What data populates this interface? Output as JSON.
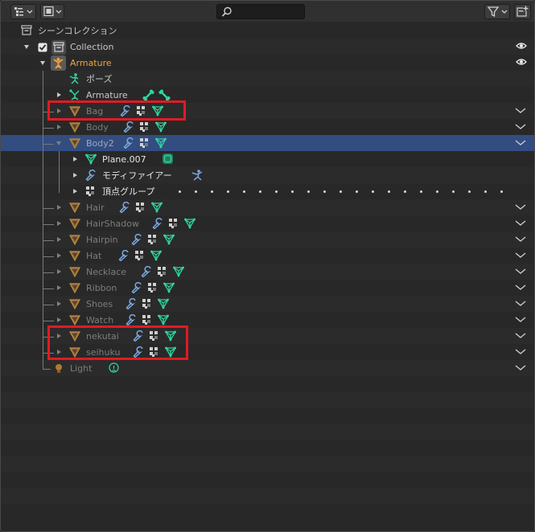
{
  "search": {
    "value": ""
  },
  "tree": {
    "scene_collection": "シーンコレクション",
    "collection": "Collection",
    "armature_object": "Armature",
    "pose": "ポーズ",
    "armature_data": "Armature",
    "bag": "Bag",
    "body": "Body",
    "body2": "Body2",
    "plane": "Plane.007",
    "modifiers": "モディファイアー",
    "vertex_groups": "頂点グループ",
    "hair": "Hair",
    "hairshadow": "HairShadow",
    "hairpin": "Hairpin",
    "hat": "Hat",
    "necklace": "Necklace",
    "ribbon": "Ribbon",
    "shoes": "Shoes",
    "watch": "Watch",
    "nekutai": "nekutai",
    "seihuku": "seihuku",
    "light": "Light"
  },
  "colors": {
    "selected_row": "#334d80",
    "highlight_box": "#e01b24",
    "active_object_text": "#f0a33d",
    "mesh_icon": "#2fd6a0",
    "wrench_icon": "#7aa7e0"
  },
  "icons": [
    "outliner-display-mode-icon",
    "view-filter-icon",
    "search-icon",
    "funnel-icon",
    "new-collection-icon",
    "collection-icon",
    "checkbox-icon",
    "eye-icon",
    "armature-icon",
    "pose-icon",
    "bone-icon",
    "mesh-object-icon",
    "mesh-data-icon",
    "wrench-icon",
    "vertex-groups-icon",
    "material-icon",
    "chevron-down-icon",
    "light-icon",
    "light-data-icon"
  ]
}
